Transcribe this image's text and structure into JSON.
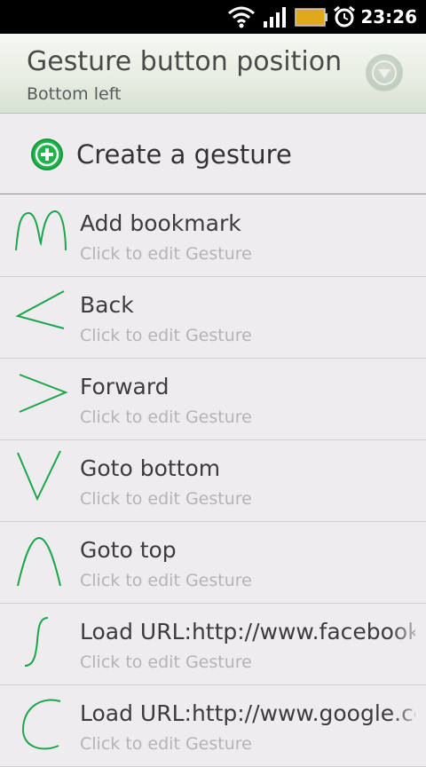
{
  "status_bar": {
    "time": "23:26",
    "icons": [
      "wifi-icon",
      "signal-icon",
      "battery-icon",
      "alarm-icon"
    ]
  },
  "header": {
    "title": "Gesture button position",
    "subtitle": "Bottom left",
    "dropdown_icon": "chevron-down-icon"
  },
  "create": {
    "label": "Create a gesture",
    "icon": "add-circle-icon",
    "icon_color": "#1db54a"
  },
  "gesture_color": "#1aa64a",
  "items": [
    {
      "name": "Add bookmark",
      "hint": "Click to edit Gesture",
      "gesture": "m-shape"
    },
    {
      "name": "Back",
      "hint": "Click to edit Gesture",
      "gesture": "less-than"
    },
    {
      "name": "Forward",
      "hint": "Click to edit Gesture",
      "gesture": "greater-than"
    },
    {
      "name": "Goto bottom",
      "hint": "Click to edit Gesture",
      "gesture": "v-shape"
    },
    {
      "name": "Goto top",
      "hint": "Click to edit Gesture",
      "gesture": "caret"
    },
    {
      "name": "Load URL:http://www.facebook.",
      "hint": "Click to edit Gesture",
      "gesture": "s-curve"
    },
    {
      "name": "Load URL:http://www.google.co",
      "hint": "Click to edit Gesture",
      "gesture": "c-curve"
    }
  ]
}
